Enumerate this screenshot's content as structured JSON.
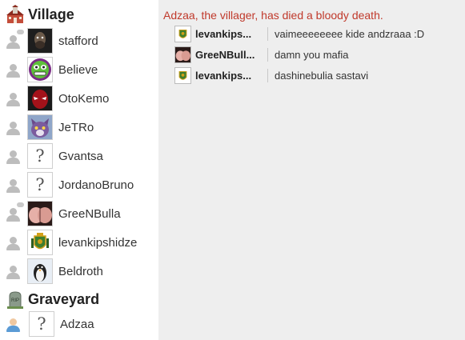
{
  "sidebar": {
    "village": {
      "title": "Village",
      "players": [
        {
          "name": "stafford",
          "avatar": "dark-portrait"
        },
        {
          "name": "Believe",
          "avatar": "green-face"
        },
        {
          "name": "OtoKemo",
          "avatar": "red-masked-hero"
        },
        {
          "name": "JeTRo",
          "avatar": "purple-cat"
        },
        {
          "name": "Gvantsa",
          "avatar": "question-mark"
        },
        {
          "name": "JordanoBruno",
          "avatar": "question-mark"
        },
        {
          "name": "GreeNBulla",
          "avatar": "pink-photo"
        },
        {
          "name": "levankipshidze",
          "avatar": "green-emblem"
        },
        {
          "name": "Beldroth",
          "avatar": "penguin"
        }
      ]
    },
    "graveyard": {
      "title": "Graveyard",
      "players": [
        {
          "name": "Adzaa",
          "avatar": "question-mark"
        }
      ]
    }
  },
  "chat": {
    "system_message": "Adzaa, the villager, has died a bloody death.",
    "messages": [
      {
        "sender": "levankips...",
        "text": "vaimeeeeeeee kide andzraaa :D"
      },
      {
        "sender": "GreeNBull...",
        "text": "damn you mafia"
      },
      {
        "sender": "levankips...",
        "text": "dashinebulia sastavi"
      }
    ]
  },
  "colors": {
    "system_message": "#c0392b",
    "chat_background": "#eeeeee"
  }
}
